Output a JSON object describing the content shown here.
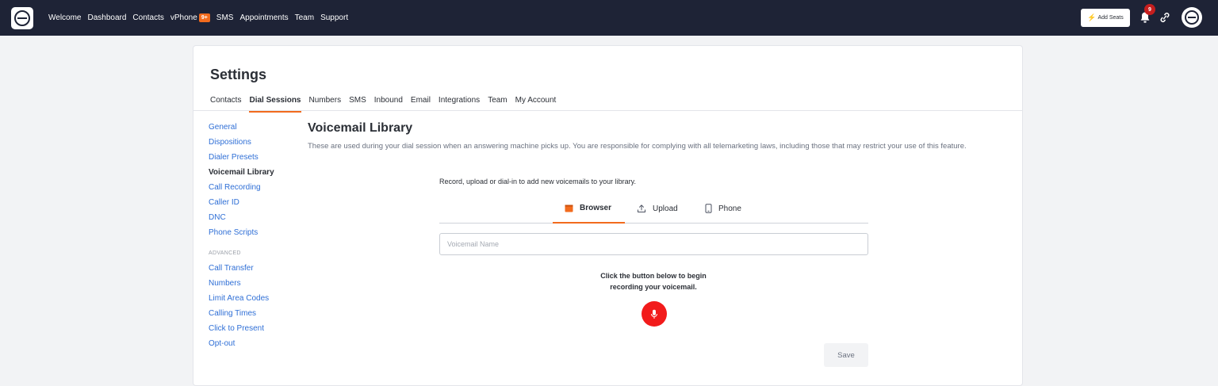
{
  "topbar": {
    "nav": [
      {
        "label": "Welcome"
      },
      {
        "label": "Dashboard"
      },
      {
        "label": "Contacts"
      },
      {
        "label": "vPhone",
        "badge": "9+"
      },
      {
        "label": "SMS"
      },
      {
        "label": "Appointments"
      },
      {
        "label": "Team"
      },
      {
        "label": "Support"
      }
    ],
    "add_seats_label": "Add Seats",
    "notification_count": "9"
  },
  "page": {
    "title": "Settings",
    "tabs": [
      "Contacts",
      "Dial Sessions",
      "Numbers",
      "SMS",
      "Inbound",
      "Email",
      "Integrations",
      "Team",
      "My Account"
    ],
    "active_tab": "Dial Sessions"
  },
  "sidebar": {
    "items": [
      "General",
      "Dispositions",
      "Dialer Presets",
      "Voicemail Library",
      "Call Recording",
      "Caller ID",
      "DNC",
      "Phone Scripts"
    ],
    "active_item": "Voicemail Library",
    "advanced_heading": "ADVANCED",
    "advanced_items": [
      "Call Transfer",
      "Numbers",
      "Limit Area Codes",
      "Calling Times",
      "Click to Present",
      "Opt-out"
    ]
  },
  "main": {
    "title": "Voicemail Library",
    "description": "These are used during your dial session when an answering machine picks up. You are responsible for complying with all telemarketing laws, including those that may restrict your use of this feature.",
    "record_hint": "Record, upload or dial-in to add new voicemails to your library.",
    "method_tabs": [
      {
        "label": "Browser",
        "icon": "browser-icon"
      },
      {
        "label": "Upload",
        "icon": "upload-icon"
      },
      {
        "label": "Phone",
        "icon": "phone-icon"
      }
    ],
    "active_method": "Browser",
    "name_placeholder": "Voicemail Name",
    "name_value": "",
    "instruction_line1": "Click the button below to begin",
    "instruction_line2": "recording your voicemail.",
    "save_label": "Save"
  },
  "colors": {
    "navbar": "#1e2336",
    "accent": "#f26b1d",
    "link": "#2f6fd6",
    "record": "#f21b1b",
    "badge": "#c61e1e"
  }
}
